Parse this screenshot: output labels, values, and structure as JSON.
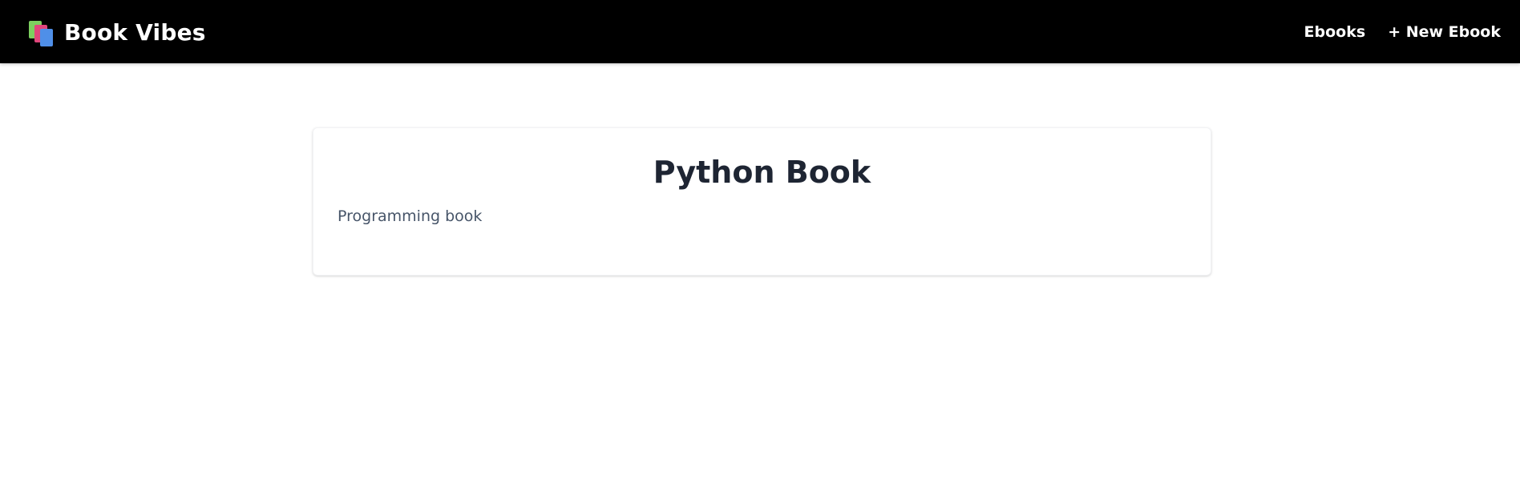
{
  "navbar": {
    "brand_name": "Book Vibes",
    "brand_icon": "books-icon",
    "links": [
      {
        "label": "Ebooks"
      },
      {
        "label": "+ New Ebook"
      }
    ],
    "background_color": "#000000",
    "text_color": "#ffffff"
  },
  "ebook": {
    "title": "Python Book",
    "description": "Programming book"
  }
}
